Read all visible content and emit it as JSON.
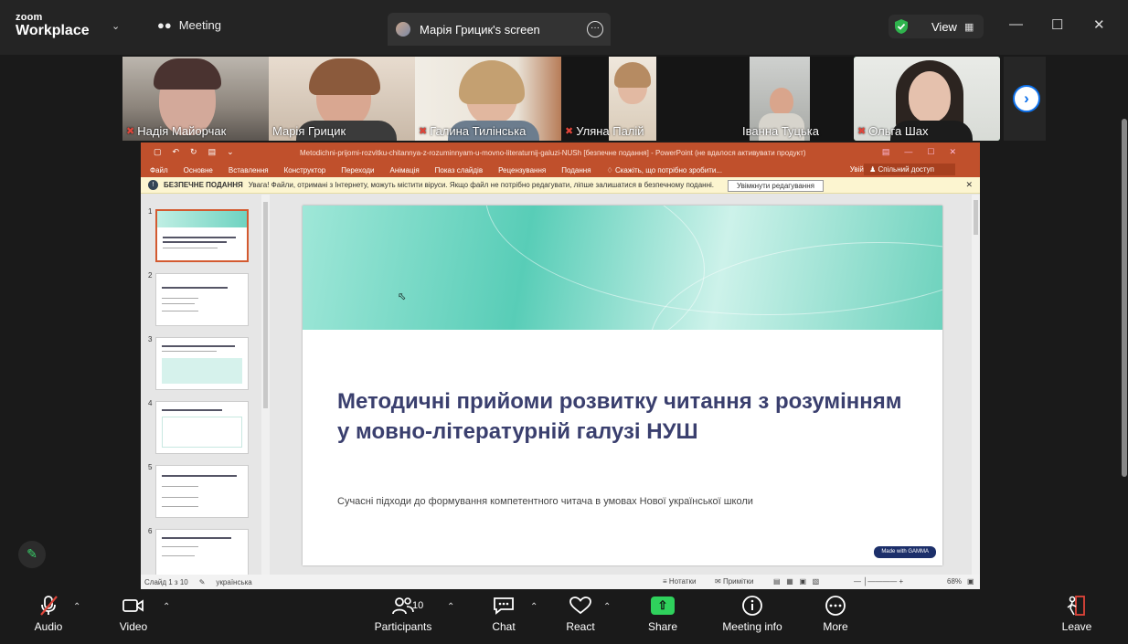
{
  "app": {
    "brand_line1": "zoom",
    "brand_line2": "Workplace",
    "meeting_label": "Meeting",
    "screen_tab_label": "Марія Грицик's screen",
    "view_label": "View"
  },
  "participants": [
    {
      "name": "Надія Майорчак",
      "muted": true
    },
    {
      "name": "Марія Грицик",
      "muted": false
    },
    {
      "name": "Галина Тилінська",
      "muted": true
    },
    {
      "name": "Уляна Палій",
      "muted": true
    },
    {
      "name": "Іванна Туцька",
      "muted": false
    },
    {
      "name": "Ольга Шах",
      "muted": true,
      "active": true
    }
  ],
  "ppt": {
    "window_title": "Metodichni-prijomi-rozvitku-chitannya-z-rozuminnyam-u-movno-literaturnij-galuzi-NUSh [безпечне подання] - PowerPoint (не вдалося активувати продукт)",
    "menu": [
      "Файл",
      "Основне",
      "Вставлення",
      "Конструктор",
      "Переходи",
      "Анімація",
      "Показ слайдів",
      "Рецензування",
      "Подання",
      "Скажіть, що потрібно зробити..."
    ],
    "signin": "Увійти",
    "share": "Спільний доступ",
    "protected_title": "БЕЗПЕЧНЕ ПОДАННЯ",
    "protected_msg": "Увага! Файли, отримані з Інтернету, можуть містити віруси. Якщо файл не потрібно редагувати, ліпше залишатися в безпечному поданні.",
    "enable_button": "Увімкнути редагування",
    "thumb_numbers": [
      "1",
      "2",
      "3",
      "4",
      "5",
      "6"
    ],
    "slide_title": "Методичні прийоми розвитку читання з розумінням у мовно-літературній галузі НУШ",
    "slide_subtitle": "Сучасні підходи до формування компетентного читача в умовах Нової української школи",
    "gamma_badge": "Made with GAMMA",
    "status_slide": "Слайд 1 з 10",
    "status_lang": "українська",
    "status_notes": "Нотатки",
    "status_comments": "Примітки",
    "zoom_level": "68%"
  },
  "toolbar": {
    "audio": "Audio",
    "video": "Video",
    "participants": "Participants",
    "participants_count": "10",
    "chat": "Chat",
    "react": "React",
    "share": "Share",
    "meeting_info": "Meeting info",
    "more": "More",
    "leave": "Leave"
  },
  "colors": {
    "accent_green": "#3ad16a",
    "zoom_blue": "#0e71eb",
    "ppt_orange": "#c0502c",
    "mute_red": "#e0453a",
    "slide_title": "#3a3f6e"
  }
}
